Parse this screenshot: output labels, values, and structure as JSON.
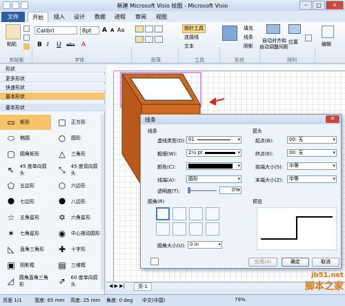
{
  "window": {
    "title": "新建 Microsoft Visio 绘图 - Microsoft Visio",
    "min": "–",
    "max": "□",
    "close": "✕"
  },
  "tabs": [
    "文件",
    "开始",
    "插入",
    "设计",
    "数据",
    "进程",
    "审阅",
    "视图"
  ],
  "ribbon": {
    "clipboard": {
      "paste": "粘贴",
      "label": "剪贴板"
    },
    "font": {
      "name": "Calibri",
      "size": "8pt",
      "grow": "A",
      "shrink": "A",
      "aa": "Aa",
      "bold": "B",
      "italic": "I",
      "underline": "U",
      "strike": "abc",
      "fontcolor": "A",
      "label": "字体"
    },
    "paragraph": {
      "label": "段落"
    },
    "tools": {
      "pointer": "指针工具",
      "connector": "连接线",
      "text": "文本",
      "label": "工具"
    },
    "shape": {
      "fill": "填充",
      "line": "线条",
      "shadow": "阴影",
      "label": "形状"
    },
    "arrange": {
      "autoalign": "自动对齐和",
      "autospace": "自动调整间距",
      "position": "位置",
      "label": "排列"
    },
    "edit": {
      "label": "编辑"
    }
  },
  "shapes_panel": {
    "header": "形状",
    "more": "更多形状",
    "quick": "快速形状",
    "basic": "基本形状",
    "section": "基本形状",
    "items": [
      "矩形",
      "正方形",
      "椭圆",
      "圆形",
      "圆角矩形",
      "三角形",
      "45 度单向箭头",
      "45 度双向箭头",
      "五边形",
      "六边形",
      "七边形",
      "八边形",
      "五角星形",
      "六角星形",
      "七角星形",
      "中心拖动圆形",
      "直角三角形",
      "十字形",
      "阴影框",
      "三维框",
      "圆角直角三角形",
      "60 度单向箭头"
    ]
  },
  "page_tab": "页-1",
  "status": {
    "page": "页面 1/1",
    "width": "宽度: 65 mm",
    "height": "高度: 25 mm",
    "angle": "角度: 0 deg",
    "lang": "中文(中国)",
    "zoom": "79%"
  },
  "dialog": {
    "title": "线条",
    "close": "✕",
    "line_section": "线条",
    "dash_label": "虚线类型(D):",
    "dash_value": "01",
    "weight_label": "粗细(W):",
    "weight_value": "2¼ pt",
    "color_label": "颜色(C):",
    "cap_label": "线端(A):",
    "cap_value": "圆形",
    "transparency_label": "透明度(T):",
    "transparency_value": "0%",
    "arrow_section": "箭头",
    "begin_label": "起点(B):",
    "begin_value": "00: 无",
    "end_label": "终点(E):",
    "end_value": "00: 无",
    "begin_size_label": "始端大小(S):",
    "begin_size_value": "中等",
    "end_size_label": "末端大小(Z):",
    "end_size_value": "中等",
    "round_section": "圆角(R)",
    "round_size_label": "圆角大小(U):",
    "round_size_value": "0 in",
    "preview_section": "预览",
    "apply": "应用(A)",
    "ok": "确定",
    "cancel": "取消"
  },
  "watermark": {
    "site": "jb51.net",
    "name": "脚本之家"
  }
}
